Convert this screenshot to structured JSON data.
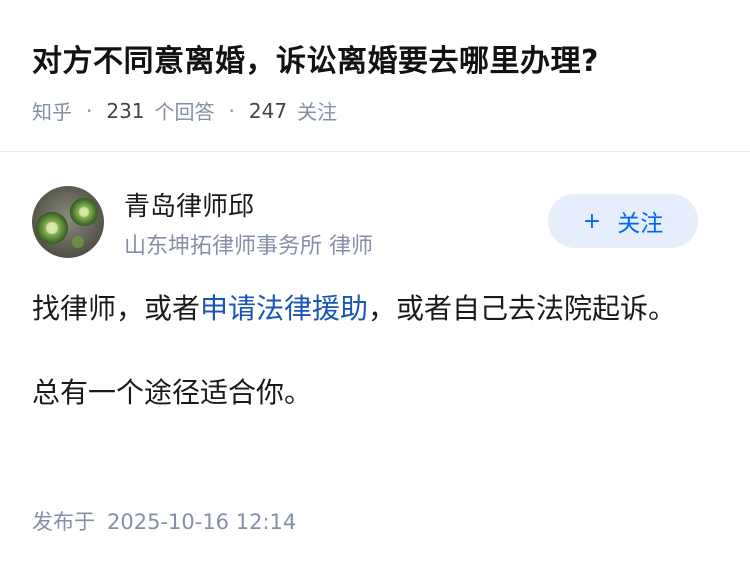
{
  "question": {
    "title": "对方不同意离婚，诉讼离婚要去哪里办理?",
    "source": "知乎",
    "answer_count": "231",
    "answer_label": "个回答",
    "follower_count": "247",
    "follower_label": "关注"
  },
  "author": {
    "name": "青岛律师邱",
    "headline": "山东坤拓律师事务所 律师",
    "avatar_icon": "avatar-succulent-plants",
    "follow_label": "关注",
    "follow_icon": "plus-icon"
  },
  "answer": {
    "p1_before": "找律师，或者",
    "p1_link": "申请法律援助",
    "p1_after": "，或者自己去法院起诉。",
    "p2": "总有一个途径适合你。",
    "published_label": "发布于",
    "published_time": "2025-10-16 12:14"
  },
  "colors": {
    "link": "#1956b5",
    "meta": "#8590a6",
    "follow_bg": "#e5eefa",
    "follow_text": "#0066ff"
  }
}
